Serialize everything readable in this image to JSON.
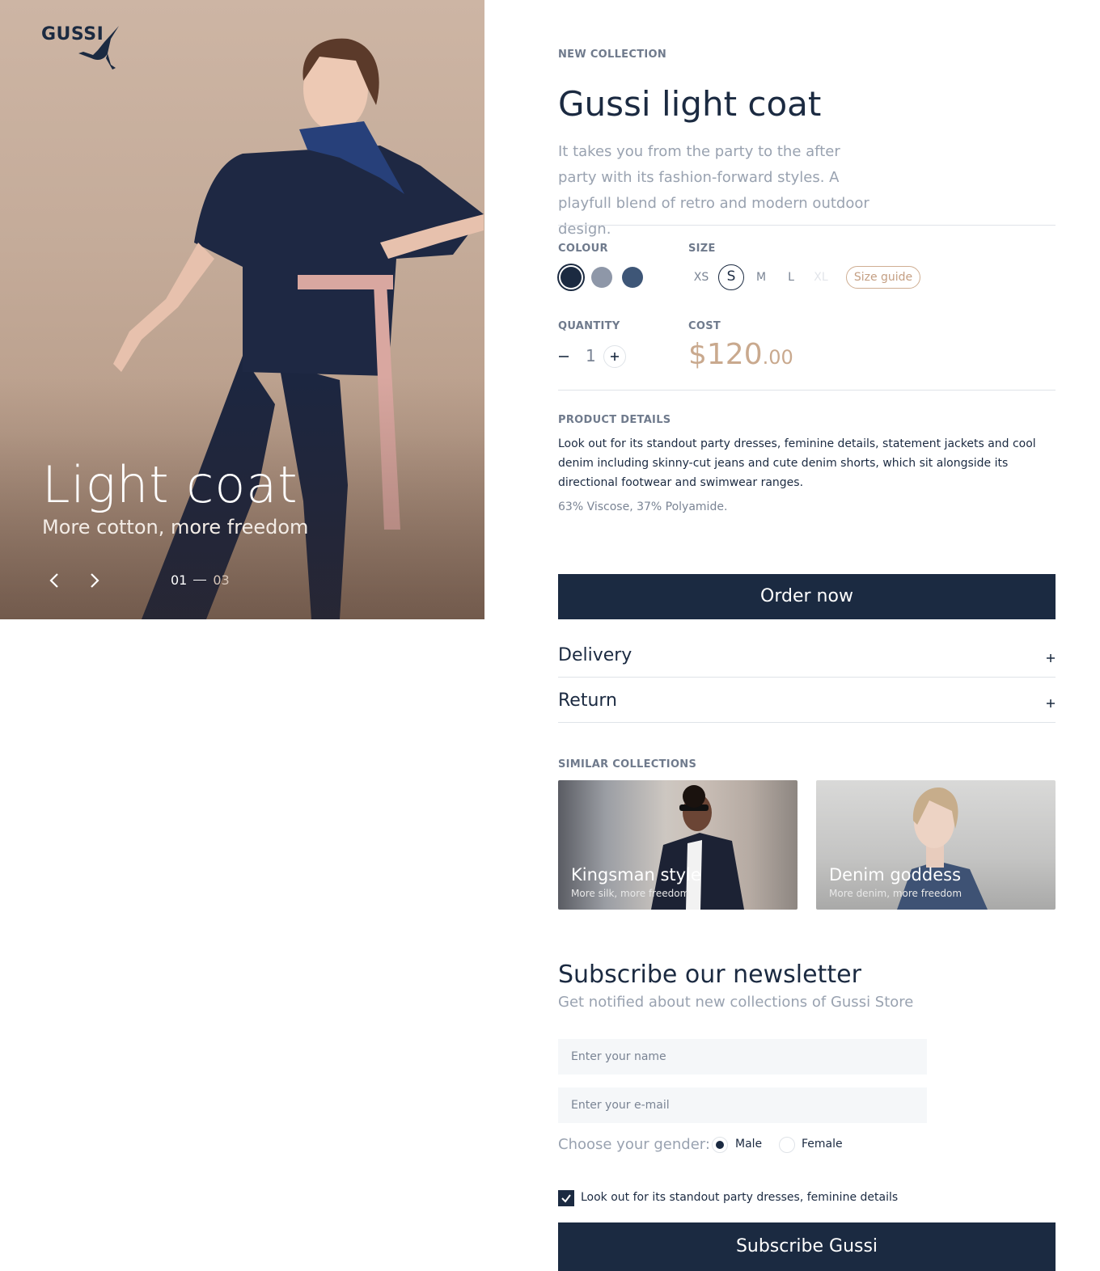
{
  "brand": {
    "name": "GUSSI"
  },
  "hero": {
    "title": "Light coat",
    "subtitle": "More cotton, more freedom",
    "pager": {
      "current": "01",
      "total": "03"
    }
  },
  "product": {
    "eyebrow": "NEW COLLECTION",
    "title": "Gussi light coat",
    "description": "It takes you from the party to the after party with its fashion-forward styles. A playfull blend of retro and modern outdoor design.",
    "colour_label": "COLOUR",
    "colours": [
      "#1b2a41",
      "#8e97a8",
      "#3e5677"
    ],
    "selected_colour": 0,
    "size_label": "SIZE",
    "sizes": [
      "XS",
      "S",
      "M",
      "L",
      "XL"
    ],
    "selected_size": "S",
    "disabled_sizes": [
      "XL"
    ],
    "size_guide": "Size guide",
    "quantity_label": "QUANTITY",
    "quantity": "1",
    "cost_label": "COST",
    "price_main": "$120",
    "price_cents": ".00",
    "details_label": "PRODUCT DETAILS",
    "details": "Look out for its standout party dresses, feminine details, statement jackets and cool denim including skinny-cut jeans and cute denim shorts, which sit alongside its directional footwear and swimwear ranges.",
    "material": "63% Viscose, 37% Polyamide.",
    "order_button": "Order now"
  },
  "accordion": [
    {
      "label": "Delivery",
      "icon": "plus-icon"
    },
    {
      "label": "Return",
      "icon": "plus-icon"
    }
  ],
  "similar": {
    "label": "SIMILAR COLLECTIONS",
    "cards": [
      {
        "title": "Kingsman style",
        "subtitle": "More silk, more freedom"
      },
      {
        "title": "Denim goddess",
        "subtitle": "More denim, more freedom"
      }
    ]
  },
  "newsletter": {
    "title": "Subscribe our newsletter",
    "subtitle": "Get notified about new collections of Gussi Store",
    "name_placeholder": "Enter your name",
    "email_placeholder": "Enter your e-mail",
    "gender_label": "Choose your gender:",
    "gender_options": [
      "Male",
      "Female"
    ],
    "gender_selected": "Male",
    "checkbox_label": "Look out for its standout party dresses, feminine details",
    "checkbox_checked": true,
    "button": "Subscribe Gussi"
  }
}
